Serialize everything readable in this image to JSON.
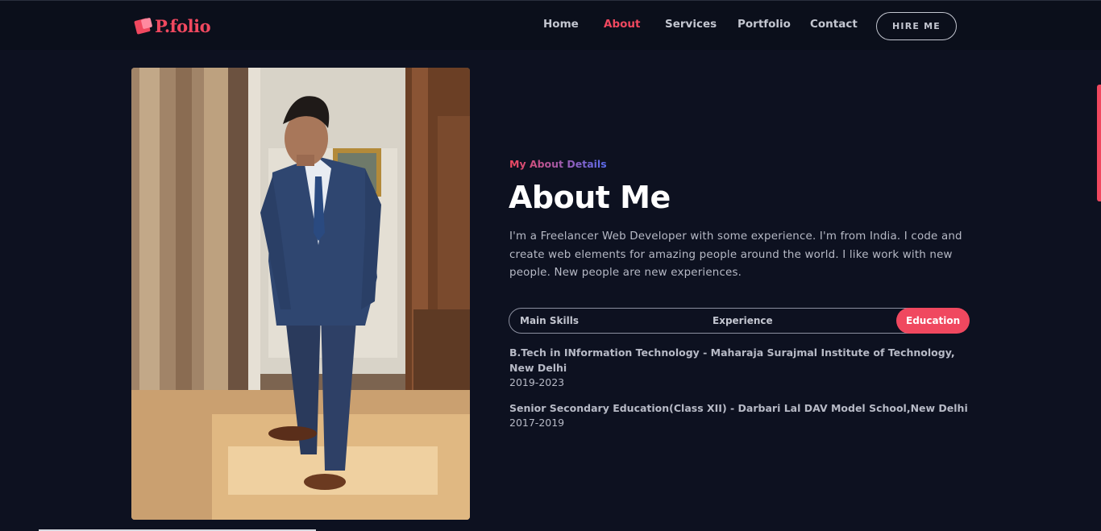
{
  "header": {
    "logo_text": "P.folio",
    "nav": [
      {
        "label": "Home",
        "active": false
      },
      {
        "label": "About",
        "active": true
      },
      {
        "label": "Services",
        "active": false
      },
      {
        "label": "Portfolio",
        "active": false
      },
      {
        "label": "Contact",
        "active": false
      }
    ],
    "hire_label": "HIRE ME"
  },
  "about": {
    "eyebrow": "My About Details",
    "title": "About Me",
    "bio": "I'm a Freelancer Web Developer with some experience. I'm from India. I code and create web elements for amazing people around the world. I like work with new people. New people are new experiences.",
    "tabs": [
      {
        "label": "Main Skills",
        "active": false
      },
      {
        "label": "Experience",
        "active": false
      },
      {
        "label": "Education",
        "active": true
      }
    ],
    "education": [
      {
        "title": "B.Tech in INformation Technology - Maharaja Surajmal Institute of Technology, New Delhi",
        "years": "2019-2023"
      },
      {
        "title": "Senior Secondary Education(Class XII) - Darbari Lal DAV Model School,New Delhi",
        "years": "2017-2019"
      }
    ]
  },
  "colors": {
    "accent": "#f0485f",
    "background": "#0d1120",
    "header": "#0b0f1b"
  },
  "icons": {
    "logo": "pink-cube-logo-icon"
  }
}
